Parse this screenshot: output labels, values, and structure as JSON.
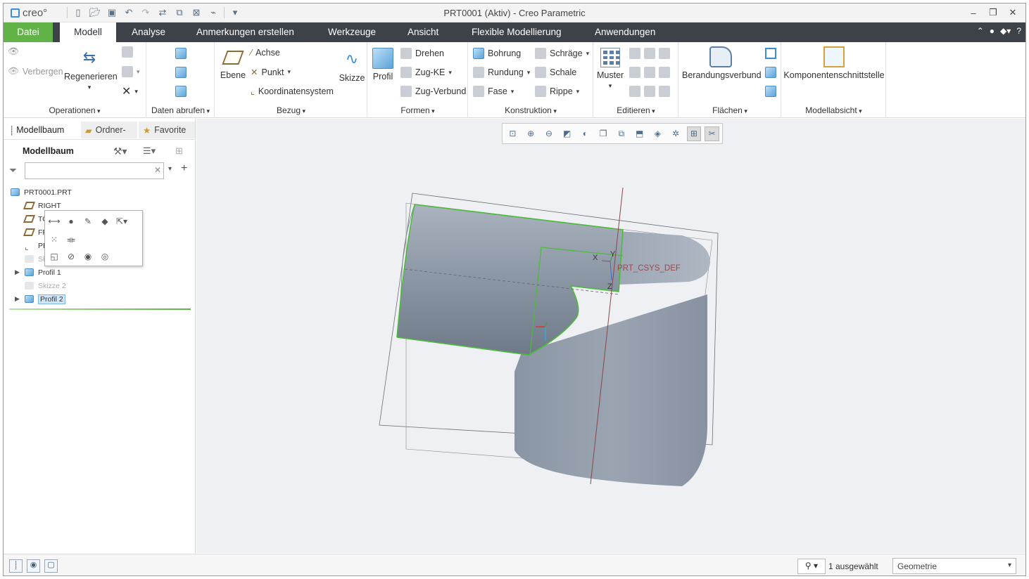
{
  "window": {
    "title": "PRT0001 (Aktiv) - Creo Parametric",
    "logo": "creo°"
  },
  "tabs": {
    "file": "Datei",
    "items": [
      "Modell",
      "Analyse",
      "Anmerkungen erstellen",
      "Werkzeuge",
      "Ansicht",
      "Flexible Modellierung",
      "Anwendungen"
    ]
  },
  "ribbon": {
    "operationen": {
      "label": "Operationen",
      "verbergen": "Verbergen",
      "regenerieren": "Regenerieren"
    },
    "daten": {
      "label": "Daten abrufen"
    },
    "bezug": {
      "label": "Bezug",
      "ebene": "Ebene",
      "achse": "Achse",
      "punkt": "Punkt",
      "koordinatensystem": "Koordinatensystem",
      "skizze": "Skizze"
    },
    "formen": {
      "label": "Formen",
      "profil": "Profil",
      "drehen": "Drehen",
      "zug_ke": "Zug-KE",
      "zug_verbund": "Zug-Verbund"
    },
    "konstruktion": {
      "label": "Konstruktion",
      "bohrung": "Bohrung",
      "rundung": "Rundung",
      "fase": "Fase",
      "schraege": "Schräge",
      "schale": "Schale",
      "rippe": "Rippe"
    },
    "editieren": {
      "label": "Editieren",
      "muster": "Muster"
    },
    "flaechen": {
      "label": "Flächen",
      "berandungsverbund": "Berandungsverbund"
    },
    "modellabsicht": {
      "label": "Modellabsicht",
      "komponentenschnittstelle": "Komponentenschnittstelle"
    }
  },
  "leftpanel": {
    "tabs": [
      "Modellbaum",
      "Ordner-",
      "Favorite"
    ],
    "tree_title": "Modellbaum",
    "filter_value": "",
    "nodes": [
      {
        "label": "PRT0001.PRT"
      },
      {
        "label": "RIGHT"
      },
      {
        "label": "TO"
      },
      {
        "label": "FR"
      },
      {
        "label": "PR"
      },
      {
        "label": "Sk"
      },
      {
        "label": "Profil 1"
      },
      {
        "label": "Skizze 2"
      },
      {
        "label": "Profil 2"
      }
    ]
  },
  "viewport": {
    "csys_label": "PRT_CSYS_DEF",
    "axis_x": "X",
    "axis_y": "Y",
    "axis_z": "Z"
  },
  "status": {
    "selected": "1 ausgewählt",
    "filter": "Geometrie"
  },
  "colors": {
    "file_tab": "#62b347",
    "tabbar": "#3d4249",
    "model_body": "#8f9aa8",
    "edge_highlight": "#4cbb3a"
  }
}
